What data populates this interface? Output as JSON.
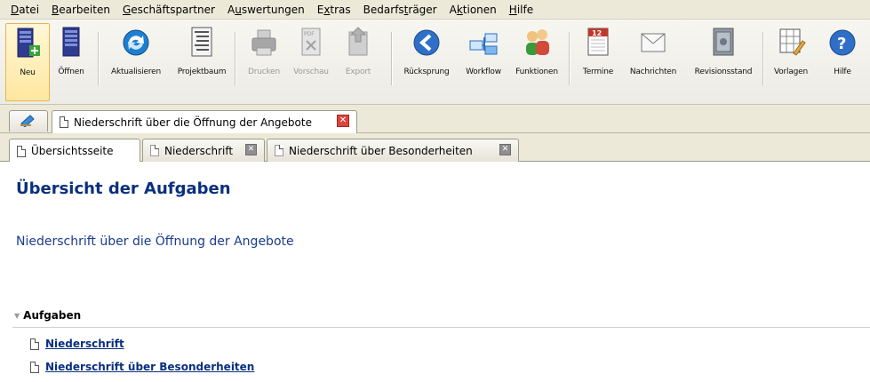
{
  "menubar": {
    "items": [
      {
        "label": "Datei",
        "accel": "D",
        "rest": "atei"
      },
      {
        "label": "Bearbeiten",
        "accel": "B",
        "rest": "earbeiten"
      },
      {
        "label": "Geschäftspartner",
        "accel": "G",
        "rest": "eschäftspartner"
      },
      {
        "label": "Auswertungen",
        "pre": "A",
        "accel": "u",
        "rest": "swertungen"
      },
      {
        "label": "Extras",
        "pre": "E",
        "accel": "x",
        "rest": "tras"
      },
      {
        "label": "Bedarfsträger",
        "pre": "Bedarfs",
        "accel": "t",
        "rest": "räger"
      },
      {
        "label": "Aktionen",
        "pre": "A",
        "accel": "k",
        "rest": "tionen"
      },
      {
        "label": "Hilfe",
        "accel": "H",
        "rest": "ilfe"
      }
    ]
  },
  "toolbar": {
    "buttons": [
      {
        "label": "Neu",
        "icon": "new-server-icon",
        "state": "selected"
      },
      {
        "label": "Öffnen",
        "icon": "open-server-icon",
        "state": "enabled"
      },
      {
        "label": "Aktualisieren",
        "icon": "refresh-icon",
        "state": "enabled"
      },
      {
        "label": "Projektbaum",
        "icon": "project-tree-icon",
        "state": "enabled"
      },
      {
        "label": "Drucken",
        "icon": "printer-icon",
        "state": "disabled"
      },
      {
        "label": "Vorschau",
        "icon": "preview-icon",
        "state": "disabled"
      },
      {
        "label": "Export",
        "icon": "export-icon",
        "state": "disabled"
      },
      {
        "label": "Rücksprung",
        "icon": "back-arrow-icon",
        "state": "enabled"
      },
      {
        "label": "Workflow",
        "icon": "workflow-icon",
        "state": "enabled"
      },
      {
        "label": "Funktionen",
        "icon": "users-icon",
        "state": "enabled"
      },
      {
        "label": "Termine",
        "icon": "calendar-icon",
        "state": "enabled"
      },
      {
        "label": "Nachrichten",
        "icon": "envelope-icon",
        "state": "enabled"
      },
      {
        "label": "Revisionsstand",
        "icon": "safe-icon",
        "state": "enabled"
      },
      {
        "label": "Vorlagen",
        "icon": "template-icon",
        "state": "enabled"
      },
      {
        "label": "Hilfe",
        "icon": "help-icon",
        "state": "enabled"
      }
    ],
    "calendar_day": "12"
  },
  "doc_tabs": {
    "active_title": "Niederschrift über die Öffnung der Angebote",
    "close_glyph": "✕"
  },
  "sub_tabs": [
    {
      "label": "Übersichtsseite",
      "active": true,
      "closable": false
    },
    {
      "label": "Niederschrift",
      "active": false,
      "closable": true
    },
    {
      "label": "Niederschrift über Besonderheiten",
      "active": false,
      "closable": true
    }
  ],
  "content": {
    "title": "Übersicht der Aufgaben",
    "subtitle": "Niederschrift über die Öffnung der Angebote",
    "section_label": "Aufgaben",
    "tasks": [
      {
        "label": "Niederschrift"
      },
      {
        "label": "Niederschrift über Besonderheiten"
      }
    ]
  },
  "colors": {
    "title": "#0a2f7f",
    "menubar_bg": "#ece9d8",
    "close_red": "#d9463c"
  }
}
